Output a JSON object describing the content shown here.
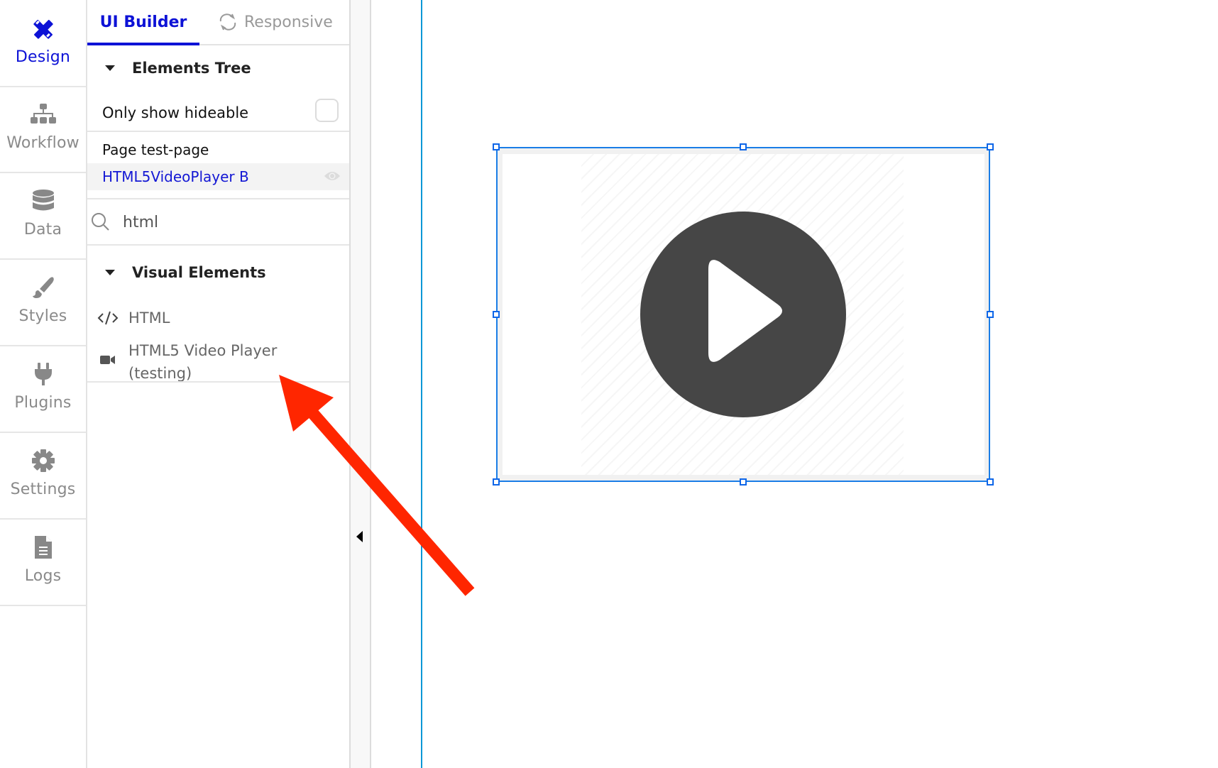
{
  "sidebar": {
    "items": [
      {
        "label": "Design",
        "icon": "design-icon",
        "active": true
      },
      {
        "label": "Workflow",
        "icon": "workflow-icon",
        "active": false
      },
      {
        "label": "Data",
        "icon": "database-icon",
        "active": false
      },
      {
        "label": "Styles",
        "icon": "brush-icon",
        "active": false
      },
      {
        "label": "Plugins",
        "icon": "plug-icon",
        "active": false
      },
      {
        "label": "Settings",
        "icon": "gear-icon",
        "active": false
      },
      {
        "label": "Logs",
        "icon": "document-icon",
        "active": false
      }
    ]
  },
  "panel": {
    "tabs": [
      {
        "label": "UI Builder",
        "active": true
      },
      {
        "label": "Responsive",
        "icon": "refresh-icon",
        "active": false
      }
    ],
    "elements_tree": {
      "title": "Elements Tree",
      "only_show_hideable_label": "Only show hideable",
      "only_show_hideable_checked": false,
      "page_label": "Page test-page",
      "selected_element": "HTML5VideoPlayer B"
    },
    "search": {
      "value": "html",
      "placeholder": ""
    },
    "visual_elements": {
      "title": "Visual Elements",
      "items": [
        {
          "label": "HTML",
          "icon": "code-icon"
        },
        {
          "label": "HTML5 Video Player (testing)",
          "line1": "HTML5 Video Player",
          "line2": "(testing)",
          "icon": "video-camera-icon"
        }
      ]
    }
  },
  "canvas": {
    "selected_element": "HTML5 Video Player",
    "play_icon": "play-circle-icon"
  },
  "annotation": {
    "type": "arrow",
    "color": "#ff2600",
    "points_to": "HTML5 Video Player (testing)"
  },
  "colors": {
    "accent": "#0d12d6",
    "selection": "#1a7de6",
    "page_edge": "#0a97d6",
    "play_button": "#464646"
  }
}
